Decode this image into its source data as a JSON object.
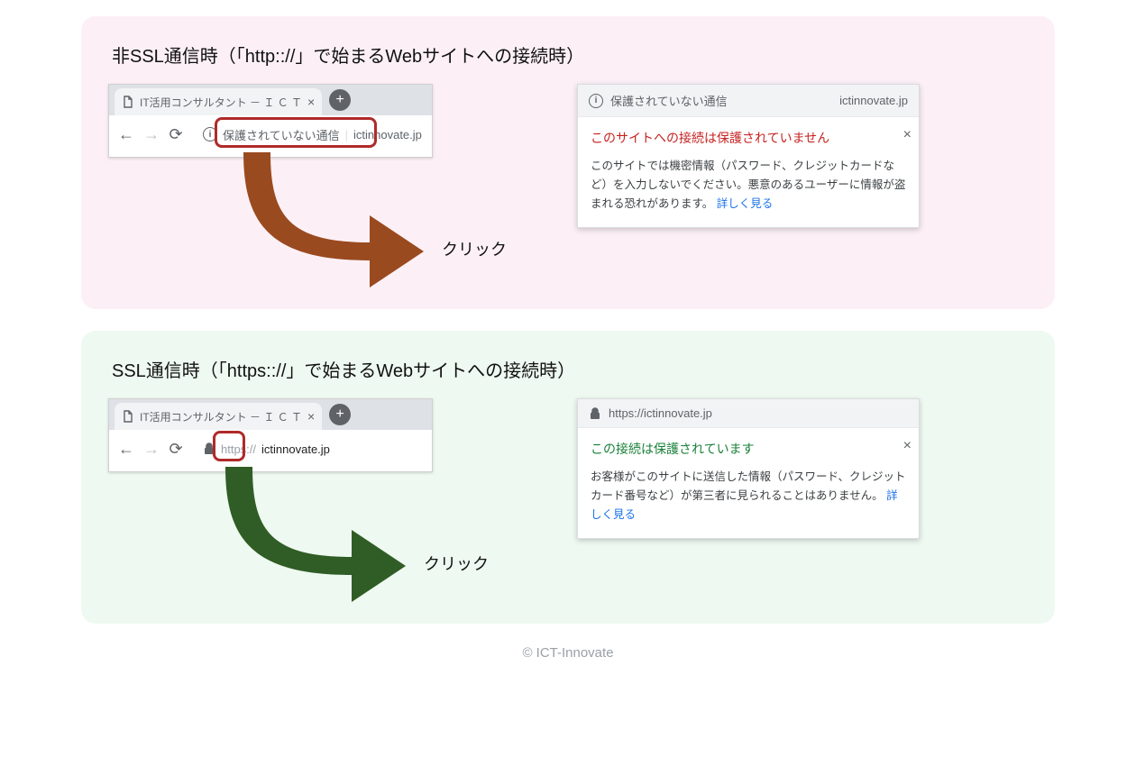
{
  "footer": "© ICT-Innovate",
  "nonssl": {
    "heading": "非SSL通信時（「http:://」で始まるWebサイトへの接続時）",
    "tab_title": "IT活用コンサルタント － Ｉ Ｃ Ｔ",
    "omnibox_label": "保護されていない通信",
    "omnibox_url": "ictinnovate.jp",
    "click_label": "クリック",
    "popup_origin": "保護されていない通信",
    "popup_origin_url": "ictinnovate.jp",
    "popup_title": "このサイトへの接続は保護されていません",
    "popup_desc": "このサイトでは機密情報（パスワード、クレジットカードなど）を入力しないでください。悪意のあるユーザーに情報が盗まれる恐れがあります。 ",
    "learn_more": "詳しく見る"
  },
  "ssl": {
    "heading": "SSL通信時（「https:://」で始まるWebサイトへの接続時）",
    "tab_title": "IT活用コンサルタント － Ｉ Ｃ Ｔ",
    "omnibox_url_prefix": "https://",
    "omnibox_url": "ictinnovate.jp",
    "click_label": "クリック",
    "popup_origin_url": "https://ictinnovate.jp",
    "popup_title": "この接続は保護されています",
    "popup_desc": "お客様がこのサイトに送信した情報（パスワード、クレジット カード番号など）が第三者に見られることはありません。 ",
    "learn_more": "詳しく見る"
  }
}
